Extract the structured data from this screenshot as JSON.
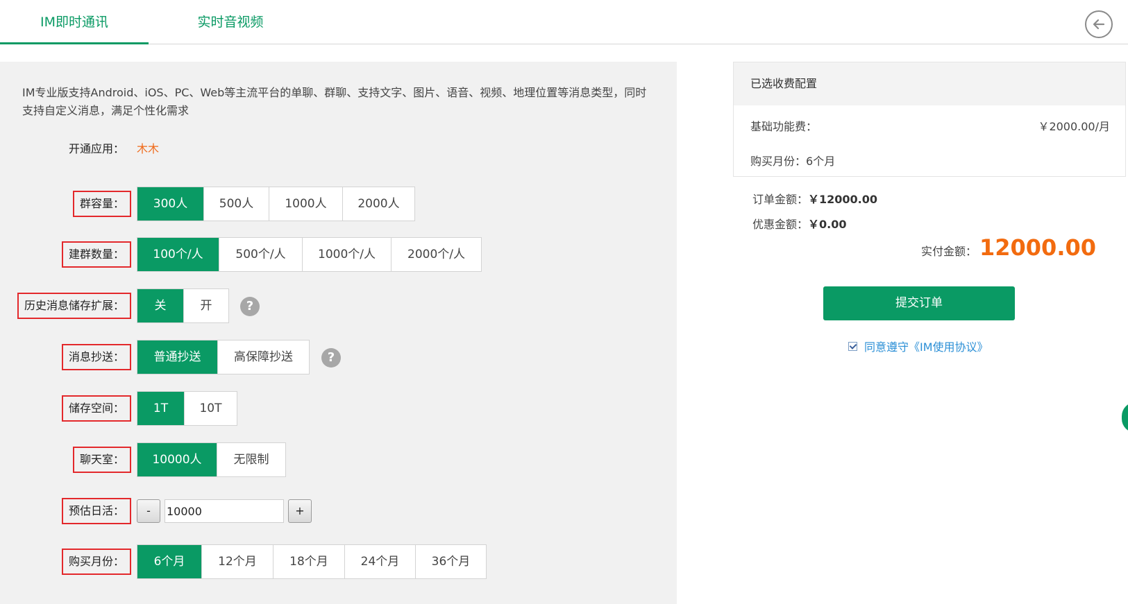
{
  "tabs": [
    {
      "label": "IM即时通讯",
      "active": true
    },
    {
      "label": "实时音视频",
      "active": false
    }
  ],
  "description": "IM专业版支持Android、iOS、PC、Web等主流平台的单聊、群聊、支持文字、图片、语音、视频、地理位置等消息类型，同时支持自定义消息，满足个性化需求",
  "app": {
    "label": "开通应用：",
    "value": "木木"
  },
  "group_capacity": {
    "label": "群容量：",
    "options": [
      "300人",
      "500人",
      "1000人",
      "2000人"
    ],
    "selected": "300人"
  },
  "group_count": {
    "label": "建群数量：",
    "options": [
      "100个/人",
      "500个/人",
      "1000个/人",
      "2000个/人"
    ],
    "selected": "100个/人"
  },
  "history_ext": {
    "label": "历史消息储存扩展：",
    "options": [
      "关",
      "开"
    ],
    "selected": "关",
    "help": "?"
  },
  "msg_copy": {
    "label": "消息抄送：",
    "options": [
      "普通抄送",
      "高保障抄送"
    ],
    "selected": "普通抄送",
    "help": "?"
  },
  "storage": {
    "label": "储存空间：",
    "options": [
      "1T",
      "10T"
    ],
    "selected": "1T"
  },
  "chatroom": {
    "label": "聊天室：",
    "options": [
      "10000人",
      "无限制"
    ],
    "selected": "10000人"
  },
  "dau": {
    "label": "预估日活：",
    "minus": "-",
    "value": "10000",
    "plus": "+"
  },
  "months": {
    "label": "购买月份：",
    "options": [
      "6个月",
      "12个月",
      "18个月",
      "24个月",
      "36个月"
    ],
    "selected": "6个月"
  },
  "summary": {
    "title": "已选收费配置",
    "base_fee_label": "基础功能费：",
    "base_fee_value": "￥2000.00/月",
    "months_label": "购买月份：",
    "months_value": "6个月"
  },
  "order": {
    "order_label": "订单金额：",
    "order_value": "￥12000.00",
    "discount_label": "优惠金额：",
    "discount_value": "￥0.00",
    "paid_label": "实付金额：",
    "paid_value": "12000.00"
  },
  "submit_label": "提交订单",
  "agreement": {
    "text": "同意遵守《IM使用协议》",
    "checked": true
  },
  "colors": {
    "accent": "#0a9a64",
    "price": "#f26b0f",
    "link": "#2b8fd6",
    "highlight_box": "#e3282b"
  },
  "icons": {
    "back": "arrow-left-circle-icon",
    "help": "question-circle-icon",
    "checkbox": "checkbox-checked-icon"
  }
}
